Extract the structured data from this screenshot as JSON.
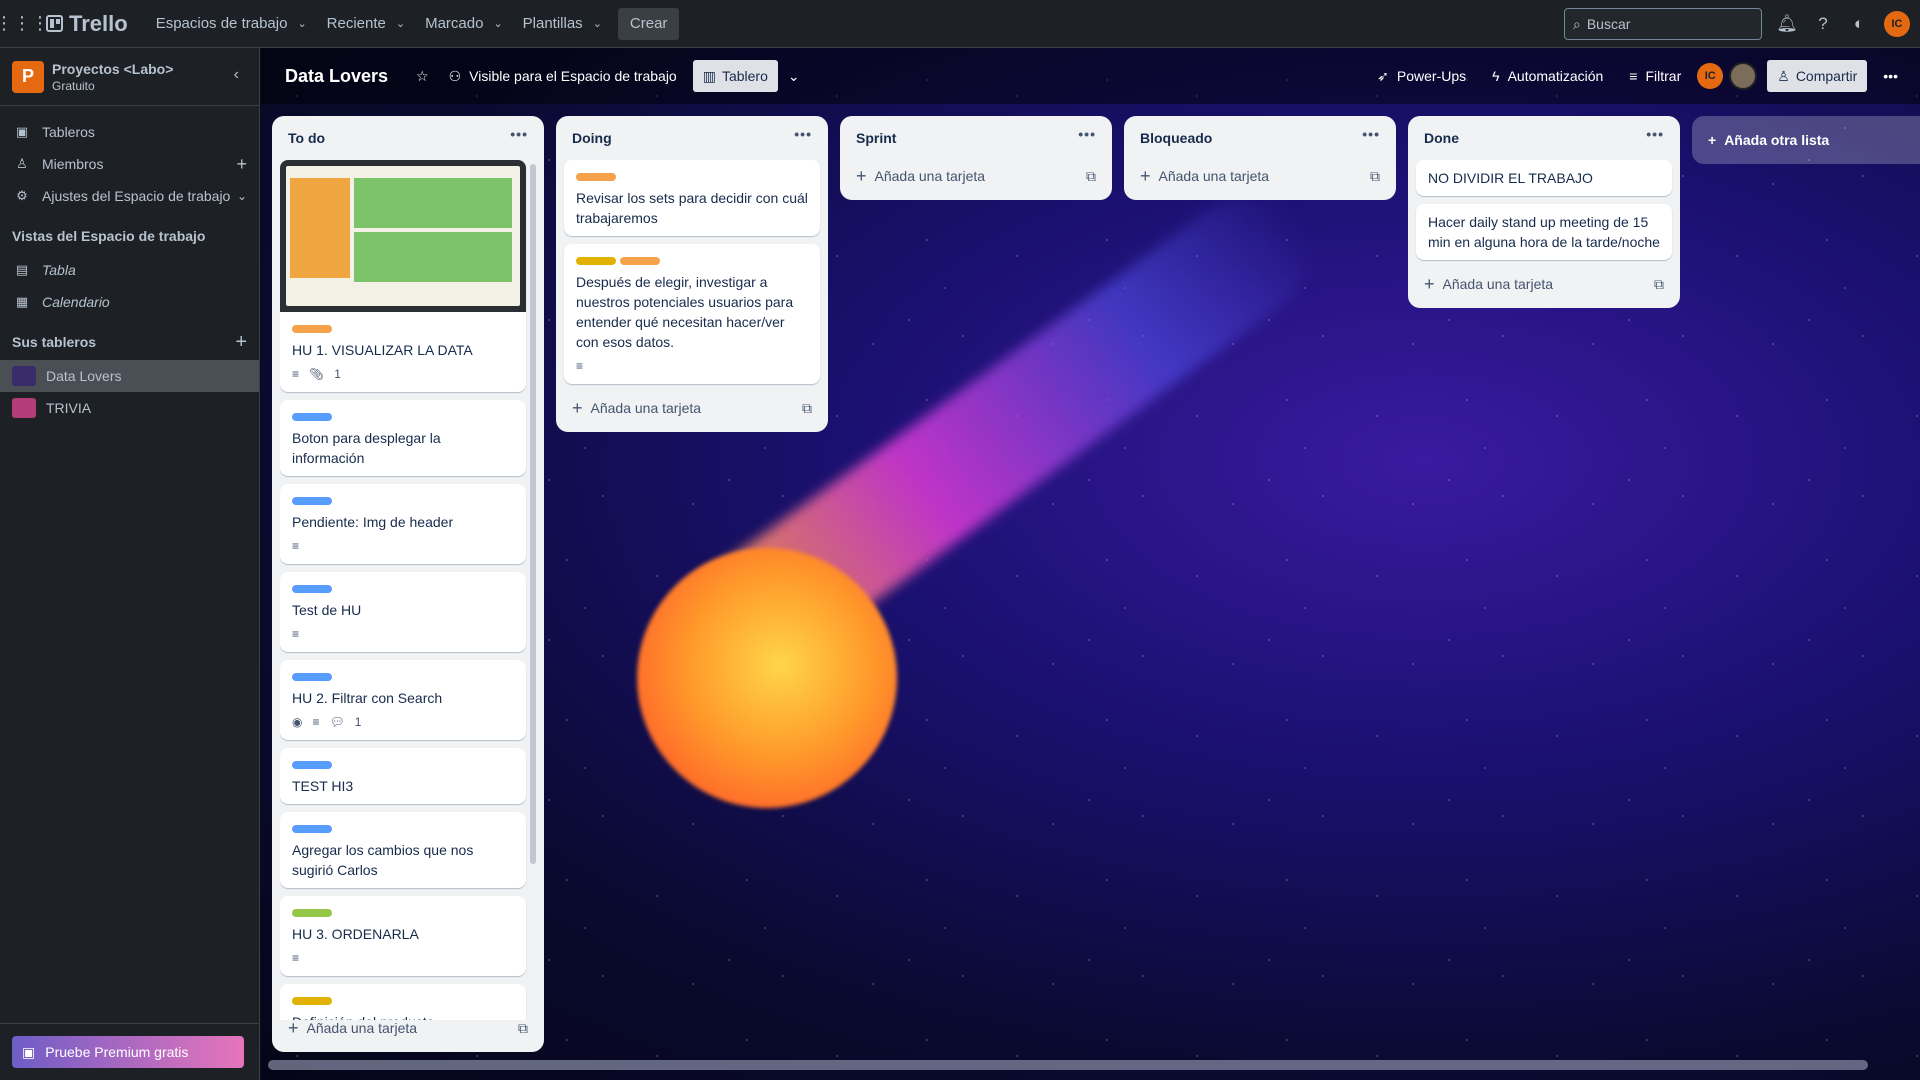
{
  "topbar": {
    "brand": "Trello",
    "menus": [
      "Espacios de trabajo",
      "Reciente",
      "Marcado",
      "Plantillas"
    ],
    "create": "Crear",
    "search_placeholder": "Buscar",
    "avatar_initials": "IC"
  },
  "sidebar": {
    "workspace_initial": "P",
    "workspace_name": "Proyectos <Labo>",
    "workspace_plan": "Gratuito",
    "items": [
      {
        "label": "Tableros",
        "icon": "board-icon"
      },
      {
        "label": "Miembros",
        "icon": "person-icon"
      },
      {
        "label": "Ajustes del Espacio de trabajo",
        "icon": "gear-icon"
      }
    ],
    "views_title": "Vistas del Espacio de trabajo",
    "views": [
      {
        "label": "Tabla",
        "icon": "table-icon"
      },
      {
        "label": "Calendario",
        "icon": "calendar-icon"
      }
    ],
    "boards_title": "Sus tableros",
    "boards": [
      {
        "label": "Data Lovers",
        "color": "#3a2b6b",
        "active": true
      },
      {
        "label": "TRIVIA",
        "color": "#b43c7a",
        "active": false
      }
    ],
    "premium": "Pruebe Premium gratis"
  },
  "board": {
    "title": "Data Lovers",
    "visibility": "Visible para el Espacio de trabajo",
    "view": "Tablero",
    "powerups": "Power-Ups",
    "automation": "Automatización",
    "filter": "Filtrar",
    "share": "Compartir",
    "member_initials": "IC"
  },
  "lists": [
    {
      "title": "To do",
      "cards": [
        {
          "labels": [
            "#f5a24b"
          ],
          "title": "HU 1. VISUALIZAR LA DATA",
          "cover": true,
          "badges": {
            "description": true,
            "attachments": "1"
          }
        },
        {
          "labels": [
            "#579dff"
          ],
          "title": "Boton para desplegar la información"
        },
        {
          "labels": [
            "#579dff"
          ],
          "title": "Pendiente: Img de header",
          "badges": {
            "description": true
          }
        },
        {
          "labels": [
            "#579dff"
          ],
          "title": "Test de HU",
          "badges": {
            "description": true
          }
        },
        {
          "labels": [
            "#579dff"
          ],
          "title": "HU 2. Filtrar con Search",
          "badges": {
            "watch": true,
            "description": true,
            "comments": "1"
          }
        },
        {
          "labels": [
            "#579dff"
          ],
          "title": "TEST HI3"
        },
        {
          "labels": [
            "#579dff"
          ],
          "title": "Agregar los cambios que nos sugirió Carlos"
        },
        {
          "labels": [
            "#94c748"
          ],
          "title": "HU 3. ORDENARLA",
          "badges": {
            "description": true
          }
        },
        {
          "labels": [
            "#e2b203"
          ],
          "title": "Definición del producto",
          "badges": {
            "description": true
          }
        }
      ],
      "add": "Añada una tarjeta"
    },
    {
      "title": "Doing",
      "cards": [
        {
          "labels": [
            "#f5a24b"
          ],
          "title": "Revisar los sets para decidir con cuál trabajaremos"
        },
        {
          "labels": [
            "#e2b203",
            "#f5a24b"
          ],
          "title": "Después de elegir, investigar a nuestros potenciales usuarios para entender qué necesitan hacer/ver con esos datos.",
          "badges": {
            "description": true
          }
        }
      ],
      "add": "Añada una tarjeta"
    },
    {
      "title": "Sprint",
      "cards": [],
      "add": "Añada una tarjeta"
    },
    {
      "title": "Bloqueado",
      "cards": [],
      "add": "Añada una tarjeta"
    },
    {
      "title": "Done",
      "cards": [
        {
          "labels": [],
          "title": "NO DIVIDIR EL TRABAJO"
        },
        {
          "labels": [],
          "title": "Hacer daily stand up meeting de 15 min en alguna hora de la tarde/noche"
        }
      ],
      "add": "Añada una tarjeta"
    }
  ],
  "add_list": "Añada otra lista"
}
